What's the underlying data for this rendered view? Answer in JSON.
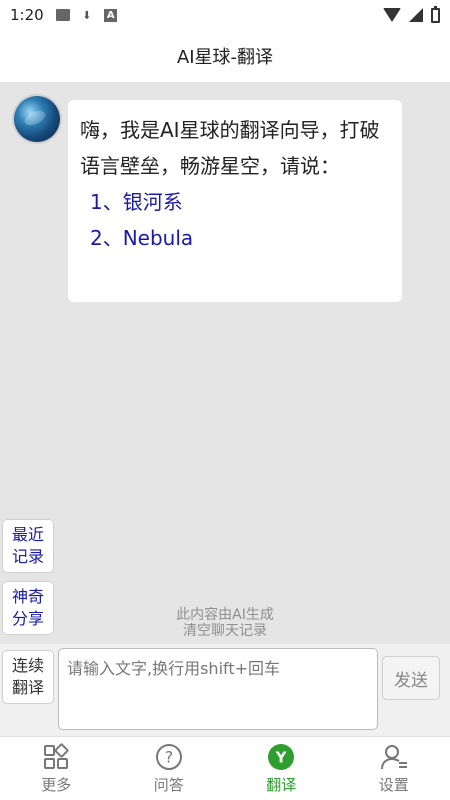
{
  "status_bar": {
    "time": "1:20",
    "icons": [
      "image-icon",
      "download-icon",
      "a-icon",
      "wifi-icon",
      "signal-icon",
      "battery-icon"
    ]
  },
  "header": {
    "title": "AI星球-翻译"
  },
  "chat": {
    "greeting": "嗨，我是AI星球的翻译向导，打破语言壁垒，畅游星空，请说：",
    "suggestions": [
      "1、银河系",
      "2、Nebula"
    ]
  },
  "side_buttons": {
    "recent": "最近\n记录",
    "share": "神奇\n分享"
  },
  "notes": {
    "ai_generated": "此内容由AI生成",
    "clear_history": "清空聊天记录"
  },
  "input": {
    "continuous_label": "连续\n翻译",
    "placeholder": "请输入文字,换行用shift+回车",
    "value": "",
    "send_label": "发送"
  },
  "nav": {
    "items": [
      {
        "label": "更多",
        "icon": "grid-icon",
        "active": false
      },
      {
        "label": "问答",
        "icon": "question-icon",
        "active": false
      },
      {
        "label": "翻译",
        "icon": "translate-icon",
        "active": true
      },
      {
        "label": "设置",
        "icon": "person-settings-icon",
        "active": false
      }
    ]
  },
  "colors": {
    "accent_green": "#2e9e2e",
    "link_blue": "#1a1aa6",
    "background": "#e5e5e5"
  }
}
